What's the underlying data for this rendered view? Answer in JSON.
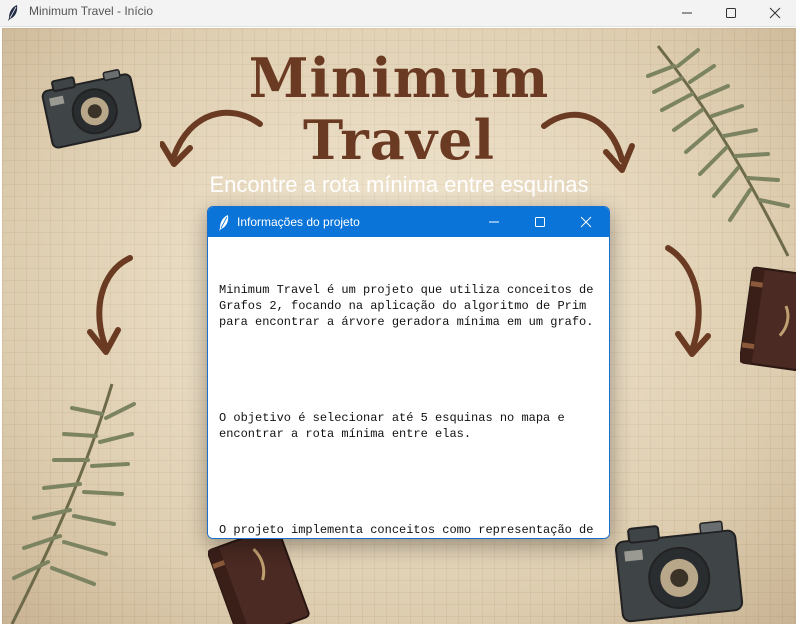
{
  "window": {
    "title": "Minimum Travel - Início",
    "icon": "feather-icon",
    "controls": [
      "minimize-icon",
      "maximize-icon",
      "close-icon"
    ]
  },
  "background": {
    "title_line1": "Minimum",
    "title_line2": "Travel",
    "subtitle": "Encontre a rota mínima entre esquinas"
  },
  "dialog": {
    "title": "Informações do projeto",
    "icon": "feather-icon",
    "paragraphs": [
      "Minimum Travel é um projeto que utiliza conceitos de Grafos 2, focando na aplicação do algoritmo de Prim para encontrar a árvore geradora mínima em um grafo.",
      "O objetivo é selecionar até 5 esquinas no mapa e encontrar a rota mínima entre elas.",
      "O projeto implementa conceitos como representação de mapa como grafo, algoritmo de Prim, cálculo de caminhos mínimos e criação de subgrafos."
    ]
  },
  "colors": {
    "accent": "#0a74d8",
    "title_brown": "#6b3a22",
    "paper": "#e9dcc3"
  }
}
